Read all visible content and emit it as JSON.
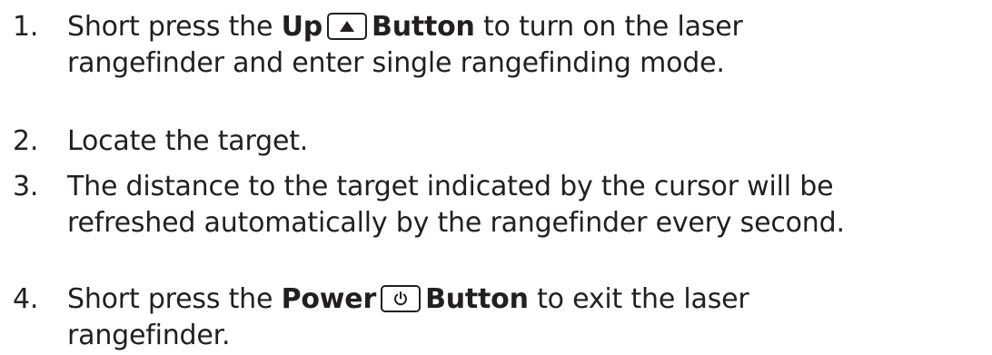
{
  "steps": [
    {
      "number": "1.",
      "line1_prefix": "Short press the ",
      "line1_bold_before": "Up",
      "icon": "up-arrow-triangle-icon",
      "line1_bold_after": "Button",
      "line1_suffix": " to turn on the laser",
      "line2": "rangefinder and enter single rangefinding mode."
    },
    {
      "number": "2.",
      "text": "Locate the target."
    },
    {
      "number": "3.",
      "line1": "The distance to the target indicated by the cursor will be",
      "line2": "refreshed automatically by the rangefinder every second."
    },
    {
      "number": "4.",
      "line1_prefix": "Short press the ",
      "line1_bold_before": "Power",
      "icon": "power-icon",
      "line1_bold_after": "Button",
      "line1_suffix": " to exit the laser",
      "line2": "rangefinder."
    }
  ]
}
